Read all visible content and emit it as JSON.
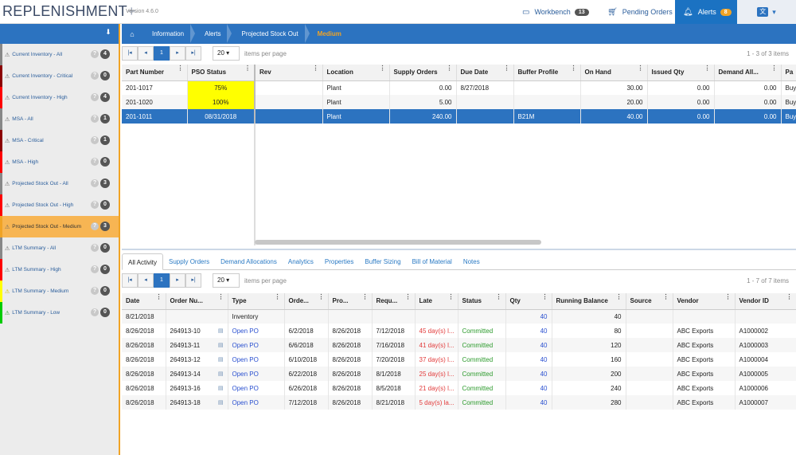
{
  "app": {
    "logo": "REPLENISHMENT",
    "logo_plus": "+",
    "version": "Version 4.6.0"
  },
  "topnav": {
    "workbench": {
      "label": "Workbench",
      "badge": "13"
    },
    "pending": {
      "label": "Pending Orders"
    },
    "alerts": {
      "label": "Alerts",
      "badge": "8"
    },
    "lang": {
      "icon": "translate-icon",
      "caret": "▾"
    }
  },
  "sidebar": {
    "download_icon": "download-icon",
    "items": [
      {
        "label": "Current Inventory - All",
        "count": "4",
        "color": "#888888"
      },
      {
        "label": "Current Inventory - Critical",
        "count": "0",
        "color": "#8b0000"
      },
      {
        "label": "Current Inventory - High",
        "count": "4",
        "color": "#ff0000"
      },
      {
        "label": "MSA - All",
        "count": "1",
        "color": "#888888"
      },
      {
        "label": "MSA - Critical",
        "count": "1",
        "color": "#8b0000"
      },
      {
        "label": "MSA - High",
        "count": "0",
        "color": "#ff0000"
      },
      {
        "label": "Projected Stock Out - All",
        "count": "3",
        "color": "#888888"
      },
      {
        "label": "Projected Stock Out - High",
        "count": "0",
        "color": "#ff0000"
      },
      {
        "label": "Projected Stock Out - Medium",
        "count": "3",
        "color": "#f0a325",
        "active": true
      },
      {
        "label": "LTM Summary - All",
        "count": "0",
        "color": "#888888"
      },
      {
        "label": "LTM Summary - High",
        "count": "0",
        "color": "#ff0000"
      },
      {
        "label": "LTM Summary - Medium",
        "count": "0",
        "color": "#ffff00"
      },
      {
        "label": "LTM Summary - Low",
        "count": "0",
        "color": "#00cc00"
      }
    ]
  },
  "breadcrumb": [
    "Information",
    "Alerts",
    "Projected Stock Out"
  ],
  "breadcrumb_current": "Medium",
  "pager_top": {
    "page": "1",
    "size": "20",
    "per_page": "items per page",
    "info": "1 - 3 of 3 items"
  },
  "grid1": {
    "columns": [
      "Part Number",
      "PSO Status",
      "Rev",
      "Location",
      "Supply Orders",
      "Due Date",
      "Buffer Profile",
      "On Hand",
      "Issued Qty",
      "Demand All...",
      "Pa"
    ],
    "rows": [
      [
        "201-1017",
        "75%",
        "",
        "Plant",
        "0.00",
        "8/27/2018",
        "",
        "30.00",
        "0.00",
        "0.00",
        "Buy"
      ],
      [
        "201-1020",
        "100%",
        "",
        "Plant",
        "5.00",
        "",
        "",
        "20.00",
        "0.00",
        "0.00",
        "Buy"
      ],
      [
        "201-1011",
        "08/31/2018",
        "",
        "Plant",
        "240.00",
        "",
        "B21M",
        "40.00",
        "0.00",
        "0.00",
        "Buy"
      ]
    ]
  },
  "tabs": [
    "All Activity",
    "Supply Orders",
    "Demand Allocations",
    "Analytics",
    "Properties",
    "Buffer Sizing",
    "Bill of Material",
    "Notes"
  ],
  "pager_bottom": {
    "page": "1",
    "size": "20",
    "per_page": "items per page",
    "info": "1 - 7 of 7 items"
  },
  "grid2": {
    "columns": [
      "Date",
      "Order Nu...",
      "Type",
      "Orde...",
      "Pro...",
      "Requ...",
      "Late",
      "Status",
      "Qty",
      "Running Balance",
      "Source",
      "Vendor",
      "Vendor ID"
    ],
    "rows": [
      [
        "8/21/2018",
        "",
        "Inventory",
        "",
        "",
        "",
        "",
        "",
        "40",
        "40",
        "",
        "",
        ""
      ],
      [
        "8/26/2018",
        "264913-10",
        "Open PO",
        "6/2/2018",
        "8/26/2018",
        "7/12/2018",
        "45 day(s) l...",
        "Committed",
        "40",
        "80",
        "",
        "ABC Exports",
        "A1000002"
      ],
      [
        "8/26/2018",
        "264913-11",
        "Open PO",
        "6/6/2018",
        "8/26/2018",
        "7/16/2018",
        "41 day(s) l...",
        "Committed",
        "40",
        "120",
        "",
        "ABC Exports",
        "A1000003"
      ],
      [
        "8/26/2018",
        "264913-12",
        "Open PO",
        "6/10/2018",
        "8/26/2018",
        "7/20/2018",
        "37 day(s) l...",
        "Committed",
        "40",
        "160",
        "",
        "ABC Exports",
        "A1000004"
      ],
      [
        "8/26/2018",
        "264913-14",
        "Open PO",
        "6/22/2018",
        "8/26/2018",
        "8/1/2018",
        "25 day(s) l...",
        "Committed",
        "40",
        "200",
        "",
        "ABC Exports",
        "A1000005"
      ],
      [
        "8/26/2018",
        "264913-16",
        "Open PO",
        "6/26/2018",
        "8/26/2018",
        "8/5/2018",
        "21 day(s) l...",
        "Committed",
        "40",
        "240",
        "",
        "ABC Exports",
        "A1000006"
      ],
      [
        "8/26/2018",
        "264913-18",
        "Open PO",
        "7/12/2018",
        "8/26/2018",
        "8/21/2018",
        "5 day(s) la...",
        "Committed",
        "40",
        "280",
        "",
        "ABC Exports",
        "A1000007"
      ]
    ]
  }
}
